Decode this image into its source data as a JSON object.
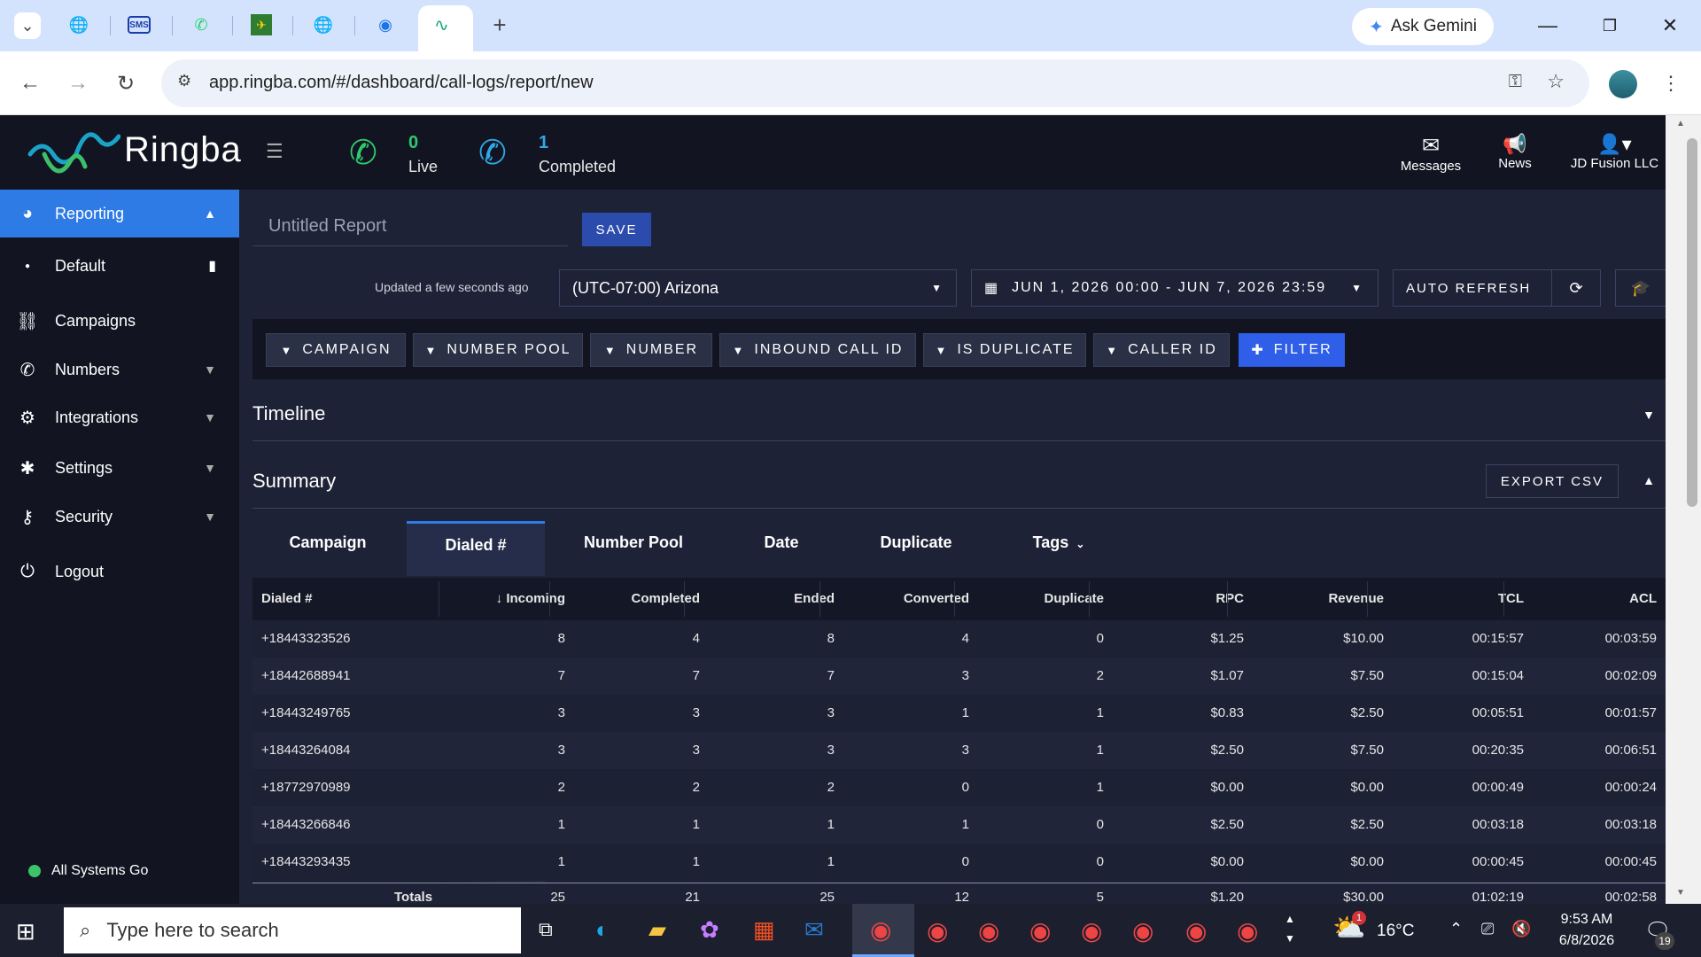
{
  "browser": {
    "tabs": [
      {
        "icon": "chevron-down-icon"
      },
      {
        "icon": "globe-icon"
      },
      {
        "icon": "sms-icon",
        "label": "SMS"
      },
      {
        "icon": "whatsapp-icon"
      },
      {
        "icon": "green-flag-icon"
      },
      {
        "icon": "globe-icon"
      },
      {
        "icon": "chrome-logo-icon"
      },
      {
        "icon": "ringba-icon"
      }
    ],
    "ask_gemini": "Ask Gemini",
    "url": "app.ringba.com/#/dashboard/call-logs/report/new"
  },
  "header": {
    "brand": "Ringba",
    "live_count": "0",
    "live_label": "Live",
    "completed_count": "1",
    "completed_label": "Completed",
    "messages": "Messages",
    "news": "News",
    "account": "JD Fusion LLC"
  },
  "sidebar": {
    "items": [
      {
        "label": "Reporting",
        "icon": "chart-pie-icon"
      },
      {
        "label": "Default"
      },
      {
        "label": "Campaigns",
        "icon": "flow-icon"
      },
      {
        "label": "Numbers",
        "icon": "phone-icon"
      },
      {
        "label": "Integrations",
        "icon": "gears-icon"
      },
      {
        "label": "Settings",
        "icon": "gear-icon"
      },
      {
        "label": "Security",
        "icon": "key-icon"
      },
      {
        "label": "Logout",
        "icon": "power-icon"
      }
    ],
    "status": "All Systems Go"
  },
  "report": {
    "title_placeholder": "Untitled Report",
    "save": "SAVE",
    "updated": "Updated a few seconds ago",
    "timezone": "(UTC-07:00) Arizona",
    "date_range": "JUN 1, 2026 00:00 - JUN 7, 2026 23:59",
    "auto_refresh": "AUTO REFRESH",
    "filters": [
      "CAMPAIGN",
      "NUMBER POOL",
      "NUMBER",
      "INBOUND CALL ID",
      "IS DUPLICATE",
      "CALLER ID"
    ],
    "add_filter": "FILTER",
    "timeline": "Timeline",
    "summary": "Summary",
    "export": "EXPORT CSV"
  },
  "summary_tabs": [
    "Campaign",
    "Dialed #",
    "Number Pool",
    "Date",
    "Duplicate",
    "Tags"
  ],
  "table": {
    "columns": [
      "Dialed #",
      "Incoming",
      "Completed",
      "Ended",
      "Converted",
      "Duplicate",
      "RPC",
      "Revenue",
      "TCL",
      "ACL"
    ],
    "rows": [
      [
        "+18443323526",
        "8",
        "4",
        "8",
        "4",
        "0",
        "$1.25",
        "$10.00",
        "00:15:57",
        "00:03:59"
      ],
      [
        "+18442688941",
        "7",
        "7",
        "7",
        "3",
        "2",
        "$1.07",
        "$7.50",
        "00:15:04",
        "00:02:09"
      ],
      [
        "+18443249765",
        "3",
        "3",
        "3",
        "1",
        "1",
        "$0.83",
        "$2.50",
        "00:05:51",
        "00:01:57"
      ],
      [
        "+18443264084",
        "3",
        "3",
        "3",
        "3",
        "1",
        "$2.50",
        "$7.50",
        "00:20:35",
        "00:06:51"
      ],
      [
        "+18772970989",
        "2",
        "2",
        "2",
        "0",
        "1",
        "$0.00",
        "$0.00",
        "00:00:49",
        "00:00:24"
      ],
      [
        "+18443266846",
        "1",
        "1",
        "1",
        "1",
        "0",
        "$2.50",
        "$2.50",
        "00:03:18",
        "00:03:18"
      ],
      [
        "+18443293435",
        "1",
        "1",
        "1",
        "0",
        "0",
        "$0.00",
        "$0.00",
        "00:00:45",
        "00:00:45"
      ]
    ],
    "totals": [
      "Totals",
      "25",
      "21",
      "25",
      "12",
      "5",
      "$1.20",
      "$30.00",
      "01:02:19",
      "00:02:58"
    ]
  },
  "taskbar": {
    "search_placeholder": "Type here to search",
    "weather": "16°C",
    "time": "9:53 AM",
    "date": "6/8/2026",
    "notifications": "19",
    "weather_badge": "1"
  }
}
